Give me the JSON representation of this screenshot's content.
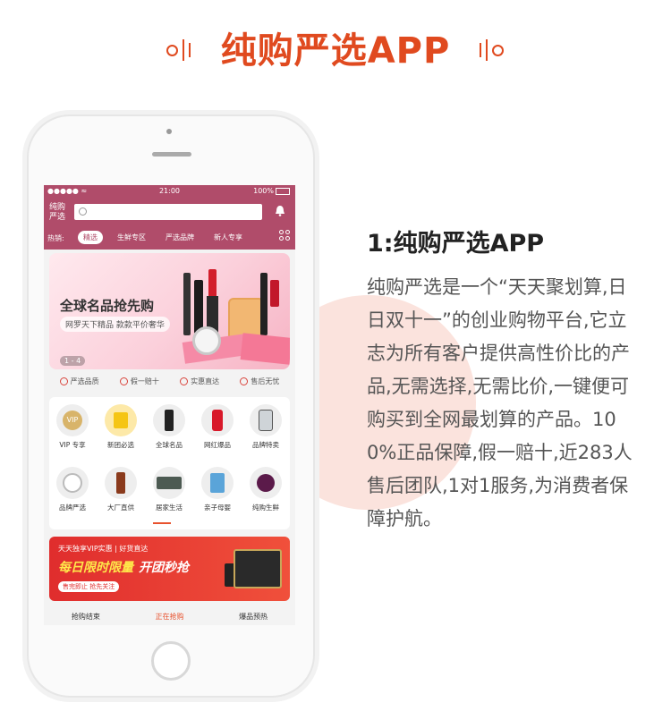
{
  "header": {
    "title": "纯购严选APP"
  },
  "phone": {
    "status": {
      "carrier": "●●●●● ≈",
      "time": "21:00",
      "battery": "100%"
    },
    "logo": "纯购严选",
    "hot_label": "热销:",
    "tabs": [
      {
        "label": "精选",
        "active": true
      },
      {
        "label": "生鲜专区",
        "active": false
      },
      {
        "label": "严选品牌",
        "active": false
      },
      {
        "label": "新人专享",
        "active": false
      }
    ],
    "banner": {
      "title": "全球名品抢先购",
      "subtitle": "网罗天下精品 款款平价奢华",
      "index": "1 - 4"
    },
    "features": [
      "严选品质",
      "假一赔十",
      "实惠直达",
      "售后无忧"
    ],
    "categories": [
      {
        "label": "VIP 专享",
        "icon": "vip-icon"
      },
      {
        "label": "新团必选",
        "icon": "bag-icon"
      },
      {
        "label": "全球名品",
        "icon": "perfume-icon"
      },
      {
        "label": "网红爆品",
        "icon": "bottle-icon"
      },
      {
        "label": "品牌特卖",
        "icon": "cup-icon"
      },
      {
        "label": "品牌严选",
        "icon": "appliance-icon"
      },
      {
        "label": "大厂直供",
        "icon": "serum-icon"
      },
      {
        "label": "居家生活",
        "icon": "bedding-icon"
      },
      {
        "label": "亲子母婴",
        "icon": "milk-icon"
      },
      {
        "label": "纯购生鲜",
        "icon": "fruit-icon"
      }
    ],
    "promo": {
      "line1": "天天独享VIP实惠 | 好货直达",
      "line2a": "每日限时限量",
      "line2b": "开团秒抢",
      "tag": "售完即止 抢先关注"
    },
    "bottom_tabs": [
      {
        "label": "抢购结束",
        "active": false
      },
      {
        "label": "正在抢购",
        "active": true
      },
      {
        "label": "爆品预热",
        "active": false
      }
    ]
  },
  "description": {
    "title": "1:纯购严选APP",
    "body": "纯购严选是一个“天天聚划算,日日双十一”的创业购物平台,它立志为所有客户提供高性价比的产品,无需选择,无需比价,一键便可购买到全网最划算的产品。100%正品保障,假一赔十,近283人售后团队,1对1服务,为消费者保障护航。"
  },
  "colors": {
    "accent": "#e04a1f",
    "app_bar": "#b04c6a",
    "promo": "#e02d2d",
    "decor_circle": "#fbe3dd"
  }
}
